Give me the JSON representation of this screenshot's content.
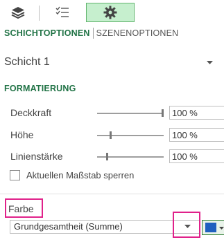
{
  "toolbar": {
    "icons": [
      "layers-icon",
      "list-icon",
      "gear-icon"
    ],
    "active": "gear-icon",
    "active_color": "#c6efce"
  },
  "tabs": {
    "active_label": "SCHICHTOPTIONEN",
    "inactive_label": "SZENENOPTIONEN"
  },
  "layer": {
    "name": "Schicht 1"
  },
  "formatting": {
    "title": "FORMATIERUNG",
    "opacity": {
      "label": "Deckkraft",
      "value": "100 %",
      "level": 1.0
    },
    "height": {
      "label": "Höhe",
      "value": "100 %",
      "level": 0.19
    },
    "thickness": {
      "label": "Linienstärke",
      "value": "100 %",
      "level": 0.14
    },
    "lock_scale": {
      "label": "Aktuellen Maßstab sperren",
      "checked": false
    }
  },
  "color": {
    "label": "Farbe",
    "aggregation": "Grundgesamtheit (Summe)",
    "swatch": "#1f5fbf",
    "highlight_color": "#e0218a"
  }
}
